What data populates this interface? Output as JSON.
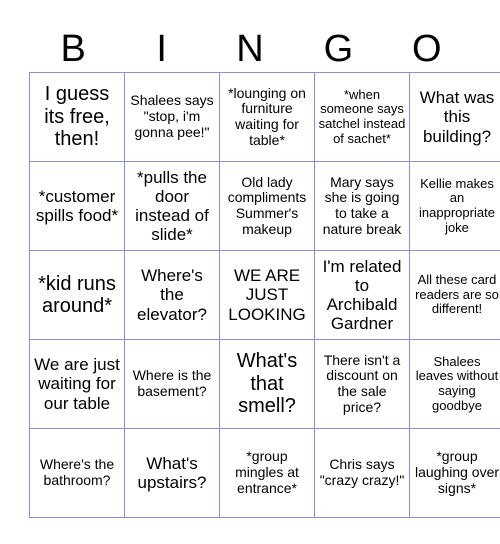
{
  "header": {
    "letters": [
      "B",
      "I",
      "N",
      "G",
      "O"
    ]
  },
  "border_color": "#8c8fc8",
  "cells": [
    [
      "I guess its free, then!",
      "Shalees says \"stop, i'm gonna pee!\"",
      "*lounging on furniture waiting for table*",
      "*when someone says satchel instead of sachet*",
      "What was this building?"
    ],
    [
      "*customer spills food*",
      "*pulls the door instead of slide*",
      "Old lady compliments Summer's makeup",
      "Mary says she is going to take a nature break",
      "Kellie makes an inappropriate joke"
    ],
    [
      "*kid runs around*",
      "Where's the elevator?",
      "WE ARE JUST LOOKING",
      "I'm related to Archibald Gardner",
      "All these card readers are so different!"
    ],
    [
      "We are just waiting for our table",
      "Where is the basement?",
      "What's that smell?",
      "There isn't a discount on the sale price?",
      "Shalees leaves without saying goodbye"
    ],
    [
      "Where's the bathroom?",
      "What's upstairs?",
      "*group mingles at entrance*",
      "Chris says \"crazy crazy!\"",
      "*group laughing over signs*"
    ]
  ]
}
